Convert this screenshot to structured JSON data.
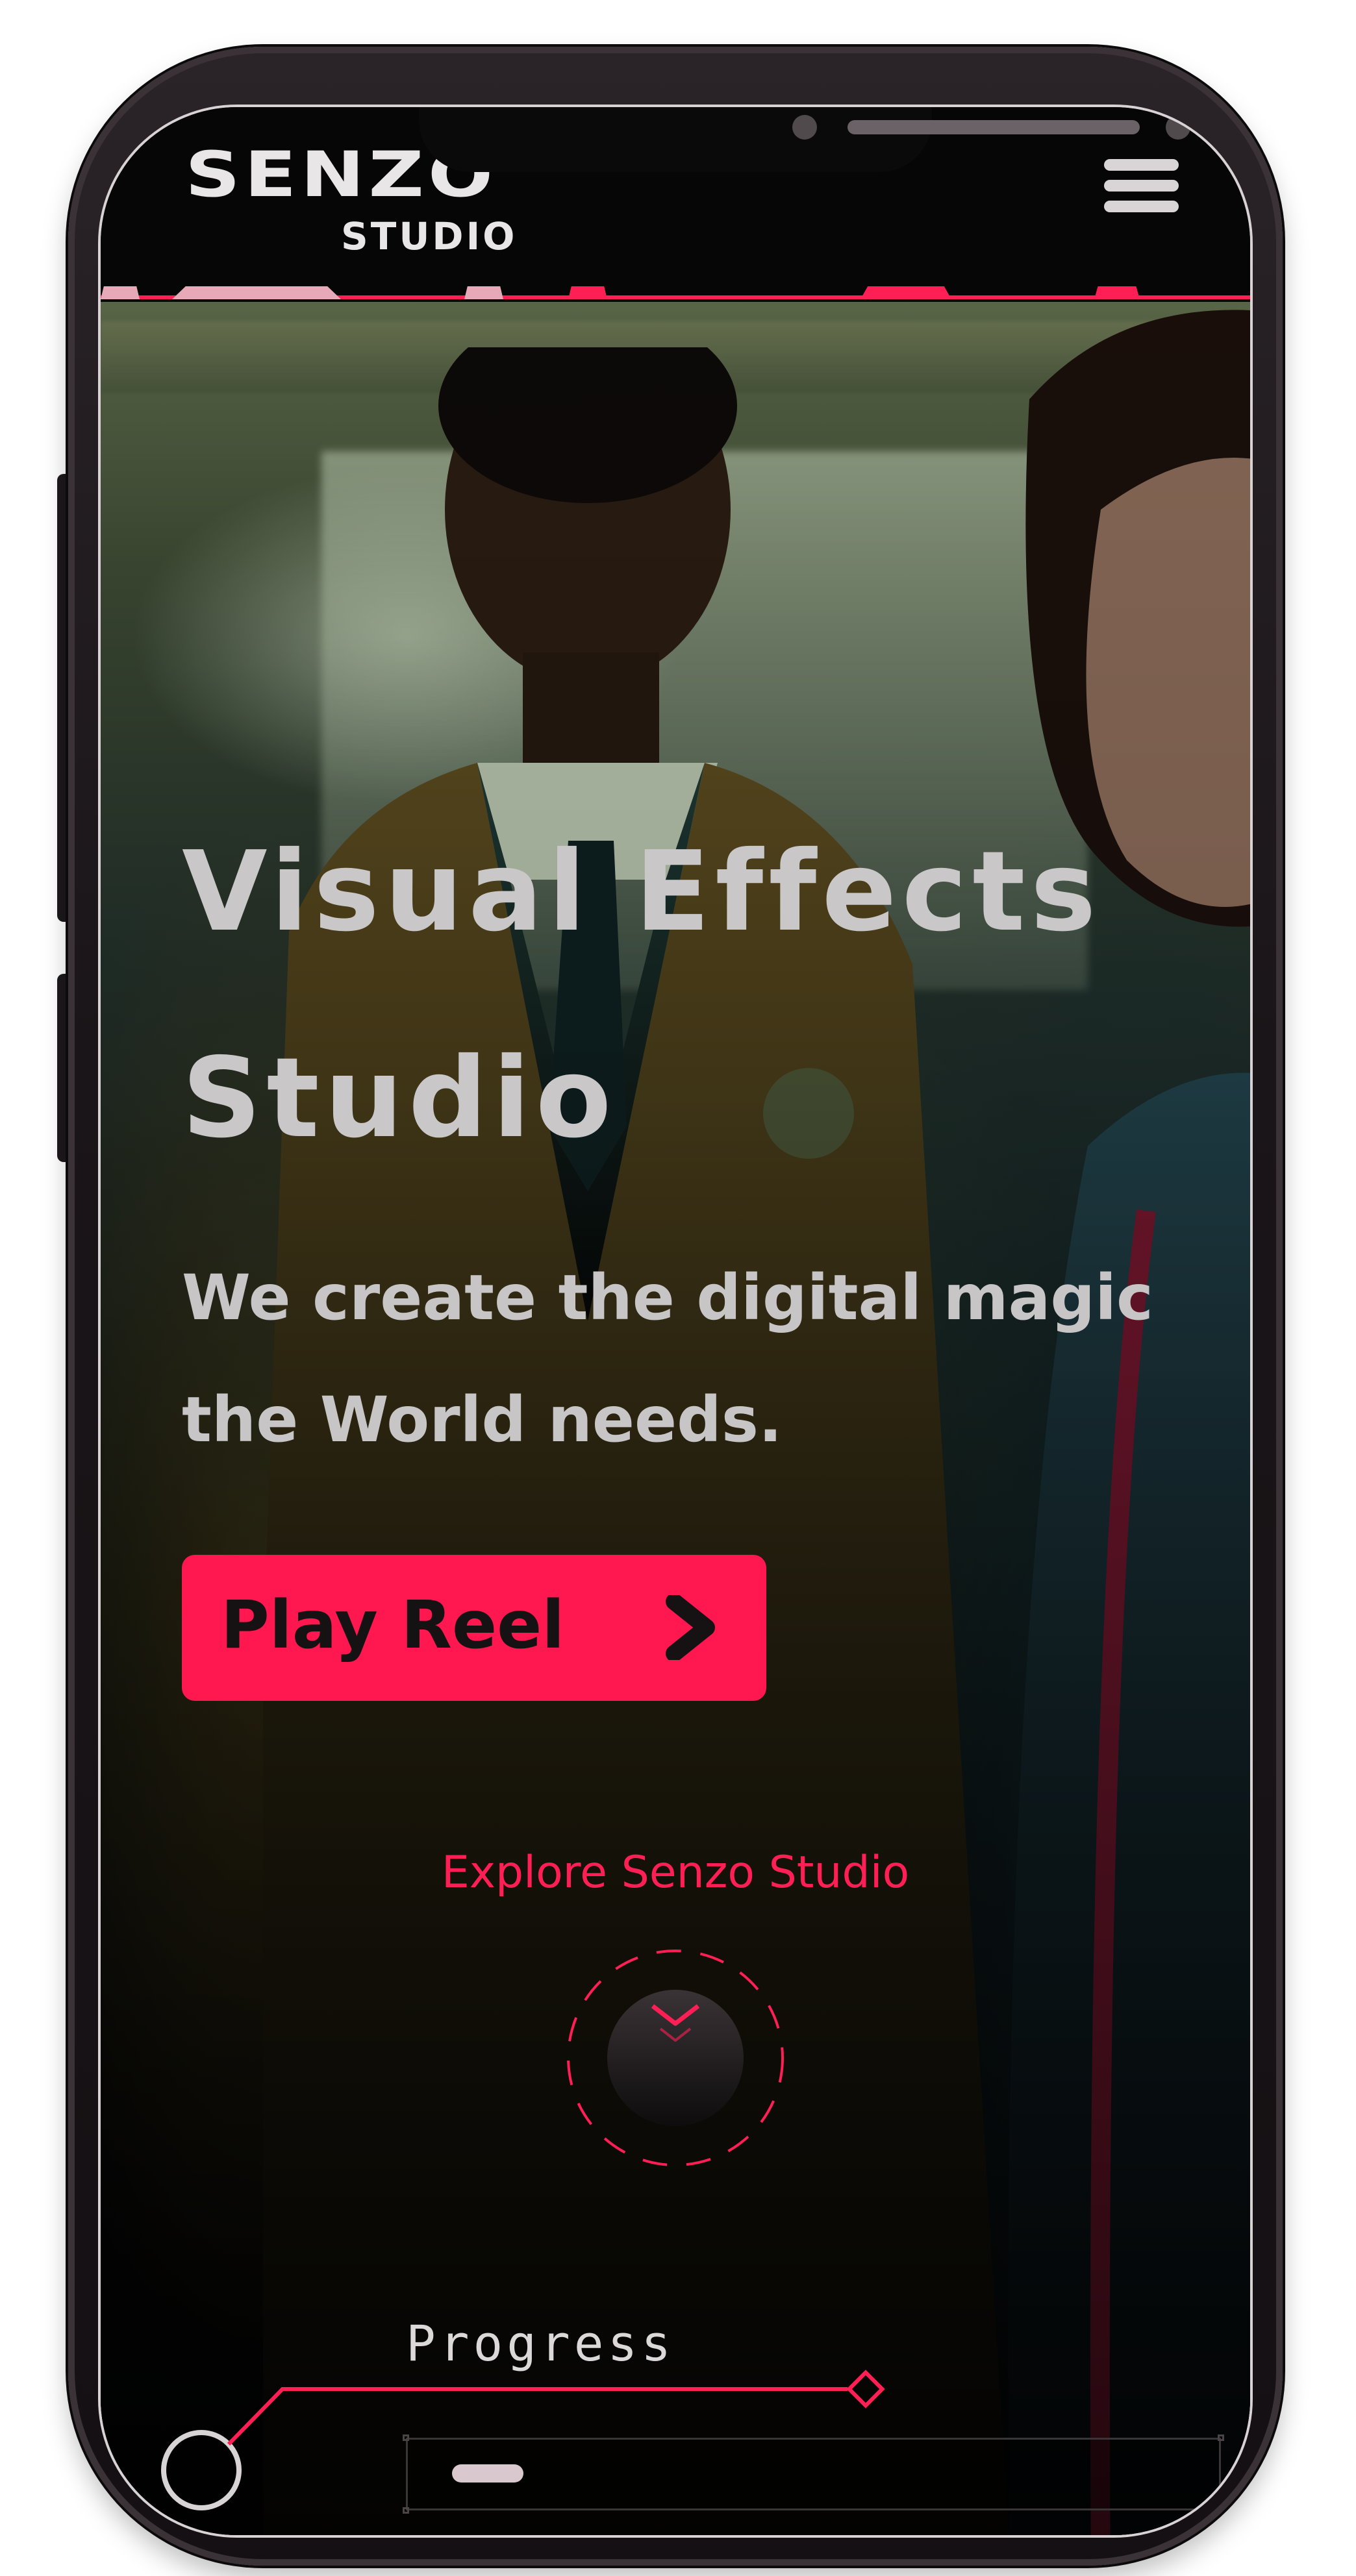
{
  "app": {
    "logo": {
      "main": "SENZO",
      "sub": "STUDIO"
    },
    "menu_icon": "hamburger-menu-icon"
  },
  "hero": {
    "title_line1": "Visual Effects",
    "title_line2": "Studio",
    "subtitle_line1": "We create the digital magic",
    "subtitle_line2": "the World needs.",
    "cta_label": "Play Reel",
    "cta_icon": "chevron-right-icon"
  },
  "explore": {
    "label": "Explore Senzo Studio",
    "icon": "chevron-down-icon"
  },
  "progress": {
    "label": "Progress",
    "value_fraction": 0.04
  },
  "colors": {
    "accent": "#ff1750",
    "text_light": "#c9c7c8",
    "background": "#050505"
  }
}
